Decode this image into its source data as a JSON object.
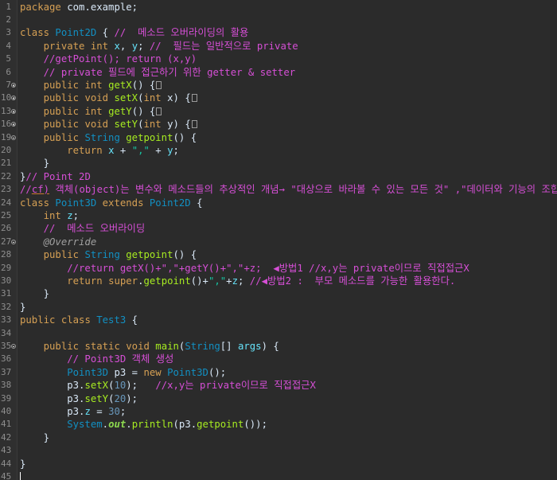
{
  "editor": {
    "lines": [
      {
        "n": "1",
        "tokens": [
          {
            "t": "package ",
            "c": "kw"
          },
          {
            "t": "com.example;",
            "c": "id"
          }
        ]
      },
      {
        "n": "2",
        "tokens": []
      },
      {
        "n": "3",
        "tokens": [
          {
            "t": "class ",
            "c": "kw"
          },
          {
            "t": "Point2D",
            "c": "cls"
          },
          {
            "t": " { ",
            "c": "id"
          },
          {
            "t": "//  메소드 오버라이딩의 활용",
            "c": "cm"
          }
        ]
      },
      {
        "n": "4",
        "tokens": [
          {
            "t": "    private ",
            "c": "kw"
          },
          {
            "t": "int ",
            "c": "kw"
          },
          {
            "t": "x",
            "c": "fld"
          },
          {
            "t": ", ",
            "c": "id"
          },
          {
            "t": "y",
            "c": "fld"
          },
          {
            "t": "; ",
            "c": "id"
          },
          {
            "t": "//  필드는 일반적으로 private",
            "c": "cm"
          }
        ]
      },
      {
        "n": "5",
        "tokens": [
          {
            "t": "    //getPoint(); return (x,y)",
            "c": "cm"
          }
        ]
      },
      {
        "n": "6",
        "tokens": [
          {
            "t": "    // private 필드에 접근하기 위한 getter & setter",
            "c": "cm"
          }
        ]
      },
      {
        "n": "7",
        "marker": "open",
        "tokens": [
          {
            "t": "    public ",
            "c": "kw"
          },
          {
            "t": "int ",
            "c": "kw"
          },
          {
            "t": "getX",
            "c": "mth"
          },
          {
            "t": "() {",
            "c": "id"
          },
          {
            "t": "",
            "c": "fold"
          }
        ]
      },
      {
        "n": "10",
        "marker": "open",
        "tokens": [
          {
            "t": "    public ",
            "c": "kw"
          },
          {
            "t": "void ",
            "c": "kw"
          },
          {
            "t": "setX",
            "c": "mth"
          },
          {
            "t": "(",
            "c": "id"
          },
          {
            "t": "int ",
            "c": "kw"
          },
          {
            "t": "x",
            "c": "id"
          },
          {
            "t": ") {",
            "c": "id"
          },
          {
            "t": "",
            "c": "fold"
          }
        ]
      },
      {
        "n": "13",
        "marker": "open",
        "tokens": [
          {
            "t": "    public ",
            "c": "kw"
          },
          {
            "t": "int ",
            "c": "kw"
          },
          {
            "t": "getY",
            "c": "mth"
          },
          {
            "t": "() {",
            "c": "id"
          },
          {
            "t": "",
            "c": "fold"
          }
        ]
      },
      {
        "n": "16",
        "marker": "open",
        "tokens": [
          {
            "t": "    public ",
            "c": "kw"
          },
          {
            "t": "void ",
            "c": "kw"
          },
          {
            "t": "setY",
            "c": "mth"
          },
          {
            "t": "(",
            "c": "id"
          },
          {
            "t": "int ",
            "c": "kw"
          },
          {
            "t": "y",
            "c": "id"
          },
          {
            "t": ") {",
            "c": "id"
          },
          {
            "t": "",
            "c": "fold"
          }
        ]
      },
      {
        "n": "19",
        "marker": "close",
        "tokens": [
          {
            "t": "    public ",
            "c": "kw"
          },
          {
            "t": "String ",
            "c": "ty"
          },
          {
            "t": "getpoint",
            "c": "mth"
          },
          {
            "t": "() {",
            "c": "id"
          }
        ]
      },
      {
        "n": "20",
        "tokens": [
          {
            "t": "        return ",
            "c": "kw"
          },
          {
            "t": "x",
            "c": "fld"
          },
          {
            "t": " + ",
            "c": "id"
          },
          {
            "t": "\",\"",
            "c": "str"
          },
          {
            "t": " + ",
            "c": "id"
          },
          {
            "t": "y",
            "c": "fld"
          },
          {
            "t": ";",
            "c": "id"
          }
        ]
      },
      {
        "n": "21",
        "tokens": [
          {
            "t": "    }",
            "c": "id"
          }
        ]
      },
      {
        "n": "22",
        "tokens": [
          {
            "t": "}",
            "c": "id"
          },
          {
            "t": "// Point 2D",
            "c": "cm"
          }
        ]
      },
      {
        "n": "23",
        "tokens": [
          {
            "t": "//",
            "c": "cm"
          },
          {
            "t": "cf)",
            "c": "cm",
            "u": true
          },
          {
            "t": " 객체(object)는 변수와 메소드들의 추상적인 개념→ \"대상으로 바라볼 수 있는 모든 것\" ,\"데이터와 기능의 조합\"",
            "c": "cm"
          }
        ]
      },
      {
        "n": "24",
        "tokens": [
          {
            "t": "class ",
            "c": "kw"
          },
          {
            "t": "Point3D ",
            "c": "cls"
          },
          {
            "t": "extends ",
            "c": "kw"
          },
          {
            "t": "Point2D",
            "c": "cls"
          },
          {
            "t": " {",
            "c": "id"
          }
        ]
      },
      {
        "n": "25",
        "tokens": [
          {
            "t": "    int ",
            "c": "kw"
          },
          {
            "t": "z",
            "c": "fld"
          },
          {
            "t": ";",
            "c": "id"
          }
        ]
      },
      {
        "n": "26",
        "tokens": [
          {
            "t": "    //  메소드 오버라이딩",
            "c": "cm"
          }
        ]
      },
      {
        "n": "27",
        "marker": "close",
        "tokens": [
          {
            "t": "    @Override",
            "c": "ann"
          }
        ]
      },
      {
        "n": "28",
        "tokens": [
          {
            "t": "    public ",
            "c": "kw"
          },
          {
            "t": "String ",
            "c": "ty"
          },
          {
            "t": "getpoint",
            "c": "mth"
          },
          {
            "t": "() {",
            "c": "id"
          }
        ]
      },
      {
        "n": "29",
        "tokens": [
          {
            "t": "        //return getX()+\",\"+getY()+\",\"+z;  ◀방법1 //x,y는 private이므로 직접접근X",
            "c": "cm"
          }
        ]
      },
      {
        "n": "30",
        "tokens": [
          {
            "t": "        return ",
            "c": "kw"
          },
          {
            "t": "super",
            "c": "kw"
          },
          {
            "t": ".",
            "c": "id"
          },
          {
            "t": "getpoint",
            "c": "mth"
          },
          {
            "t": "()+",
            "c": "id"
          },
          {
            "t": "\",\"",
            "c": "str"
          },
          {
            "t": "+",
            "c": "id"
          },
          {
            "t": "z",
            "c": "fld"
          },
          {
            "t": "; ",
            "c": "id"
          },
          {
            "t": "//◀방법2 :  부모 메소드를 가능한 활용한다.",
            "c": "cm"
          }
        ]
      },
      {
        "n": "31",
        "tokens": [
          {
            "t": "    }",
            "c": "id"
          }
        ]
      },
      {
        "n": "32",
        "tokens": [
          {
            "t": "}",
            "c": "id"
          }
        ]
      },
      {
        "n": "33",
        "tokens": [
          {
            "t": "public ",
            "c": "kw"
          },
          {
            "t": "class ",
            "c": "kw"
          },
          {
            "t": "Test3",
            "c": "cls"
          },
          {
            "t": " {",
            "c": "id"
          }
        ]
      },
      {
        "n": "34",
        "tokens": []
      },
      {
        "n": "35",
        "marker": "close",
        "tokens": [
          {
            "t": "    public ",
            "c": "kw"
          },
          {
            "t": "static ",
            "c": "kw"
          },
          {
            "t": "void ",
            "c": "kw"
          },
          {
            "t": "main",
            "c": "mth"
          },
          {
            "t": "(",
            "c": "id"
          },
          {
            "t": "String",
            "c": "ty"
          },
          {
            "t": "[] ",
            "c": "id"
          },
          {
            "t": "args",
            "c": "fld"
          },
          {
            "t": ") {",
            "c": "id"
          }
        ]
      },
      {
        "n": "36",
        "tokens": [
          {
            "t": "        // Point3D 객체 생성",
            "c": "cm"
          }
        ]
      },
      {
        "n": "37",
        "tokens": [
          {
            "t": "        Point3D ",
            "c": "cls"
          },
          {
            "t": "p3",
            "c": "id"
          },
          {
            "t": " = ",
            "c": "id"
          },
          {
            "t": "new ",
            "c": "kw"
          },
          {
            "t": "Point3D",
            "c": "cls"
          },
          {
            "t": "();",
            "c": "id"
          }
        ]
      },
      {
        "n": "38",
        "tokens": [
          {
            "t": "        p3.",
            "c": "id"
          },
          {
            "t": "setX",
            "c": "mth"
          },
          {
            "t": "(",
            "c": "id"
          },
          {
            "t": "10",
            "c": "num"
          },
          {
            "t": ");   ",
            "c": "id"
          },
          {
            "t": "//x,y는 private이므로 직접접근X",
            "c": "cm"
          }
        ]
      },
      {
        "n": "39",
        "tokens": [
          {
            "t": "        p3.",
            "c": "id"
          },
          {
            "t": "setY",
            "c": "mth"
          },
          {
            "t": "(",
            "c": "id"
          },
          {
            "t": "20",
            "c": "num"
          },
          {
            "t": ");",
            "c": "id"
          }
        ]
      },
      {
        "n": "40",
        "tokens": [
          {
            "t": "        p3.",
            "c": "id"
          },
          {
            "t": "z",
            "c": "fld"
          },
          {
            "t": " = ",
            "c": "id"
          },
          {
            "t": "30",
            "c": "num"
          },
          {
            "t": ";",
            "c": "id"
          }
        ]
      },
      {
        "n": "41",
        "tokens": [
          {
            "t": "        System",
            "c": "cls"
          },
          {
            "t": ".",
            "c": "id"
          },
          {
            "t": "out",
            "c": "out"
          },
          {
            "t": ".",
            "c": "id"
          },
          {
            "t": "println",
            "c": "mth"
          },
          {
            "t": "(p3.",
            "c": "id"
          },
          {
            "t": "getpoint",
            "c": "mth"
          },
          {
            "t": "());",
            "c": "id"
          }
        ]
      },
      {
        "n": "42",
        "tokens": [
          {
            "t": "    }",
            "c": "id"
          }
        ]
      },
      {
        "n": "43",
        "tokens": []
      },
      {
        "n": "44",
        "tokens": [
          {
            "t": "}",
            "c": "id"
          }
        ]
      },
      {
        "n": "45",
        "cursor": true,
        "tokens": []
      }
    ]
  },
  "colors": {
    "background": "#2b2b2b",
    "keyword": "#d6a054",
    "type": "#1290c3",
    "field": "#66e1f8",
    "method": "#a7ec21",
    "comment": "#d64fd6",
    "string": "#17c6a3",
    "number": "#6897bb"
  }
}
